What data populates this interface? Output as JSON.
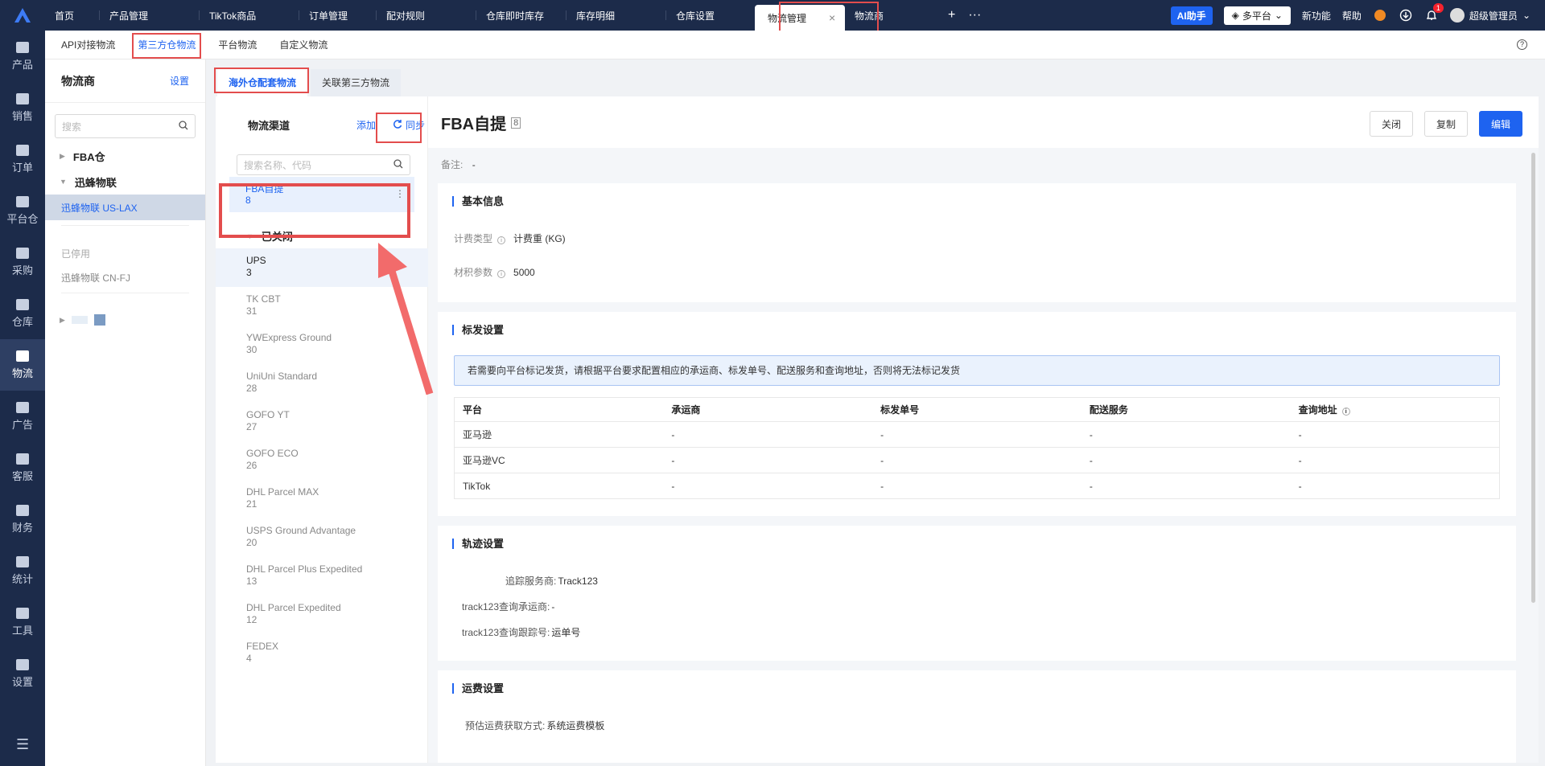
{
  "topnav": {
    "tabs": [
      "首页",
      "产品管理",
      "TikTok商品",
      "订单管理",
      "配对规则",
      "仓库即时库存",
      "库存明细",
      "仓库设置",
      "物流管理",
      "物流商"
    ],
    "active_tab": "物流管理",
    "plus": "+",
    "dots": "···",
    "ai": "AI助手",
    "platform": "多平台",
    "new_feature": "新功能",
    "help": "帮助",
    "bell_count": "1",
    "user": "超级管理员"
  },
  "leftnav": [
    "产品",
    "销售",
    "订单",
    "平台仓",
    "采购",
    "仓库",
    "物流",
    "广告",
    "客服",
    "财务",
    "统计",
    "工具",
    "设置"
  ],
  "subnav": [
    "API对接物流",
    "第三方仓物流",
    "平台物流",
    "自定义物流"
  ],
  "provider": {
    "title": "物流商",
    "settings": "设置",
    "search_placeholder": "搜索",
    "groups": [
      "FBA仓",
      "迅蜂物联"
    ],
    "active_leaf": "迅蜂物联 US-LAX",
    "disabled_label": "已停用",
    "disabled_item": "迅蜂物联 CN-FJ"
  },
  "content_tabs": [
    "海外仓配套物流",
    "关联第三方物流"
  ],
  "channels": {
    "title": "物流渠道",
    "add": "添加",
    "sync": "同步",
    "search_placeholder": "搜索名称、代码",
    "active": {
      "name": "FBA自提",
      "code": "8"
    },
    "closed_label": "已关闭",
    "closed": [
      {
        "name": "UPS",
        "code": "3"
      },
      {
        "name": "TK CBT",
        "code": "31"
      },
      {
        "name": "YWExpress Ground",
        "code": "30"
      },
      {
        "name": "UniUni Standard",
        "code": "28"
      },
      {
        "name": "GOFO YT",
        "code": "27"
      },
      {
        "name": "GOFO ECO",
        "code": "26"
      },
      {
        "name": "DHL Parcel MAX",
        "code": "21"
      },
      {
        "name": "USPS Ground Advantage",
        "code": "20"
      },
      {
        "name": "DHL Parcel Plus Expedited",
        "code": "13"
      },
      {
        "name": "DHL Parcel Expedited",
        "code": "12"
      },
      {
        "name": "FEDEX",
        "code": "4"
      }
    ]
  },
  "detail": {
    "title": "FBA自提",
    "count": "8",
    "btn_close": "关闭",
    "btn_copy": "复制",
    "btn_edit": "编辑",
    "remark_label": "备注:",
    "remark_value": "-",
    "basic": {
      "title": "基本信息",
      "billing_label": "计费类型",
      "billing_value": "计费重 (KG)",
      "volume_label": "材积参数",
      "volume_value": "5000"
    },
    "mark": {
      "title": "标发设置",
      "notice": "若需要向平台标记发货，请根据平台要求配置相应的承运商、标发单号、配送服务和查询地址，否则将无法标记发货",
      "columns": [
        "平台",
        "承运商",
        "标发单号",
        "配送服务",
        "查询地址"
      ],
      "rows": [
        [
          "亚马逊",
          "-",
          "-",
          "-",
          "-"
        ],
        [
          "亚马逊VC",
          "-",
          "-",
          "-",
          "-"
        ],
        [
          "TikTok",
          "-",
          "-",
          "-",
          "-"
        ]
      ]
    },
    "track": {
      "title": "轨迹设置",
      "provider_label": "追踪服务商:",
      "provider_value": "Track123",
      "carrier_label": "track123查询承运商:",
      "carrier_value": "-",
      "number_label": "track123查询跟踪号:",
      "number_value": "运单号"
    },
    "freight": {
      "title": "运费设置",
      "method_label": "预估运费获取方式:",
      "method_value": "系统运费模板"
    }
  }
}
